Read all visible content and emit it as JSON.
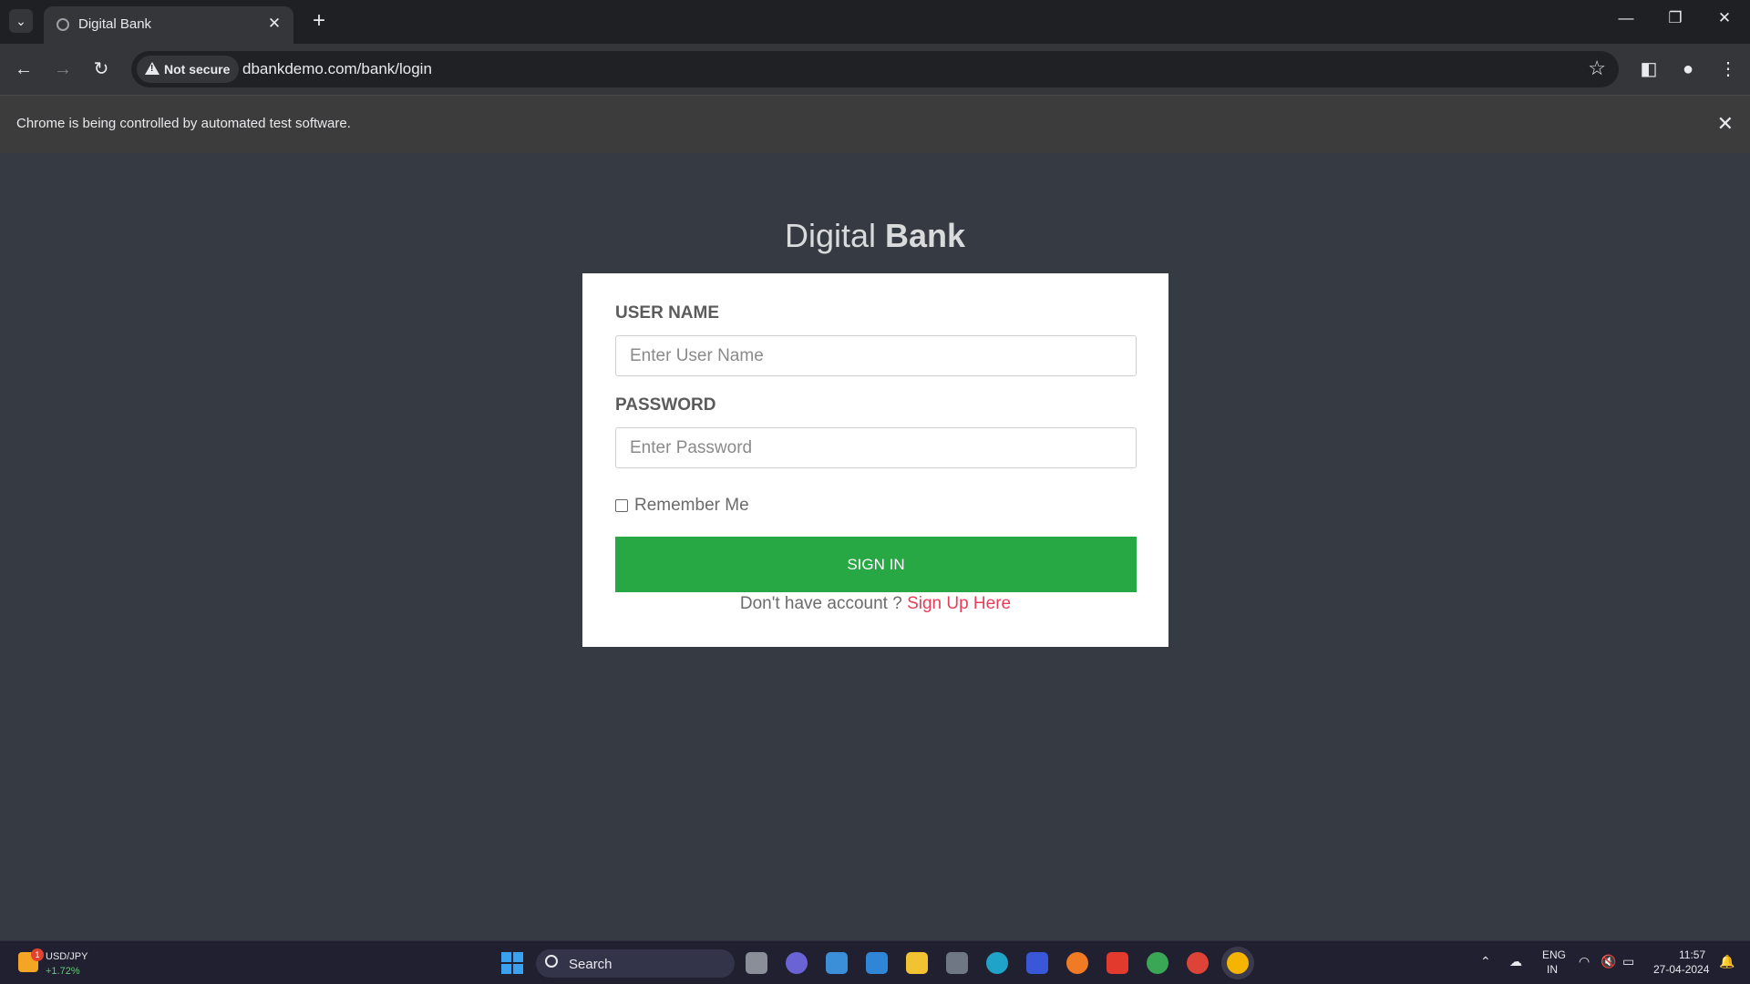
{
  "browser": {
    "tab_title": "Digital Bank",
    "security_chip": "Not secure",
    "url": "dbankdemo.com/bank/login",
    "infobar_text": "Chrome is being controlled by automated test software."
  },
  "login": {
    "brand_light": "Digital",
    "brand_bold": "Bank",
    "username_label": "USER NAME",
    "username_placeholder": "Enter User Name",
    "password_label": "PASSWORD",
    "password_placeholder": "Enter Password",
    "remember_label": "Remember Me",
    "signin_label": "SIGN IN",
    "signup_prompt": "Don't have account ?",
    "signup_link": "Sign Up Here"
  },
  "taskbar": {
    "ticker_name": "USD/JPY",
    "ticker_change": "+1.72%",
    "ticker_badge": "1",
    "search_label": "Search",
    "lang_top": "ENG",
    "lang_bottom": "IN",
    "time": "11:57",
    "date": "27-04-2024"
  },
  "colors": {
    "page_bg": "#353a43",
    "signin_green": "#28a745",
    "signup_link": "#e83e5a"
  }
}
